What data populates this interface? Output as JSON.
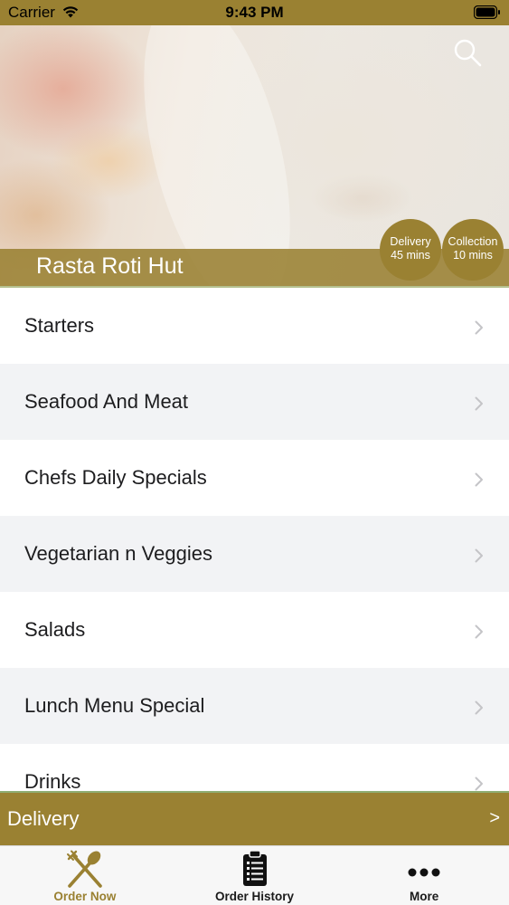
{
  "status_bar": {
    "carrier": "Carrier",
    "time": "9:43 PM"
  },
  "restaurant": {
    "name": "Rasta Roti Hut"
  },
  "badges": {
    "delivery": {
      "label": "Delivery",
      "time": "45 mins"
    },
    "collection": {
      "label": "Collection",
      "time": "10 mins"
    }
  },
  "menu": {
    "categories": [
      "Starters",
      "Seafood And Meat",
      "Chefs Daily Specials",
      "Vegetarian n Veggies",
      "Salads",
      "Lunch Menu Special",
      "Drinks"
    ]
  },
  "delivery_bar": {
    "label": "Delivery",
    "arrow": ">"
  },
  "tabs": [
    {
      "label": "Order Now",
      "icon": "fork-spoon-icon",
      "active": true
    },
    {
      "label": "Order History",
      "icon": "clipboard-list-icon",
      "active": false
    },
    {
      "label": "More",
      "icon": "more-dots-icon",
      "active": false
    }
  ],
  "colors": {
    "brand": "#9a8132",
    "accent_line": "#8fae73",
    "row_alt": "#f2f3f5"
  }
}
